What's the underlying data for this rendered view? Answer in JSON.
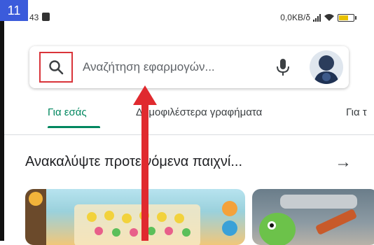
{
  "step_number": "11",
  "status_bar": {
    "time": "43",
    "network_speed": "0,0KB/δ",
    "icons": [
      "signal-icon",
      "wifi-icon",
      "battery-icon"
    ]
  },
  "search": {
    "placeholder": "Αναζήτηση εφαρμογών...",
    "icons": [
      "search-icon",
      "mic-icon",
      "avatar"
    ]
  },
  "tabs": [
    {
      "label": "Για εσάς",
      "active": true
    },
    {
      "label": "Δημοφιλέστερα γραφήματα",
      "active": false
    },
    {
      "label": "Για τ",
      "active": false
    }
  ],
  "section": {
    "title": "Ανακαλύψτε προτεινόμενα παιχνί...",
    "arrow": "→"
  },
  "colors": {
    "accent_green": "#01875f",
    "highlight_red": "#d9343a",
    "step_badge_blue": "#3b5bdb",
    "annotation_arrow_red": "#e02a2f"
  }
}
